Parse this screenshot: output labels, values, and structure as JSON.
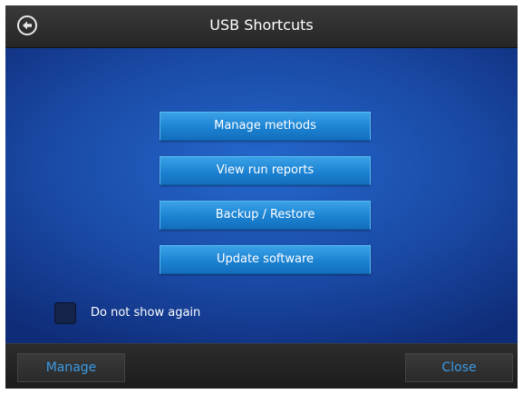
{
  "header": {
    "title": "USB Shortcuts",
    "back_icon": "back-arrow-circle-icon"
  },
  "menu": {
    "items": [
      {
        "label": "Manage methods"
      },
      {
        "label": "View run reports"
      },
      {
        "label": "Backup / Restore"
      },
      {
        "label": "Update software"
      }
    ]
  },
  "option": {
    "checkbox_label": "Do not show again",
    "checked": false
  },
  "footer": {
    "left_label": "Manage",
    "right_label": "Close"
  },
  "colors": {
    "accent_blue": "#1c82d2",
    "footer_text": "#3a9ae6"
  }
}
